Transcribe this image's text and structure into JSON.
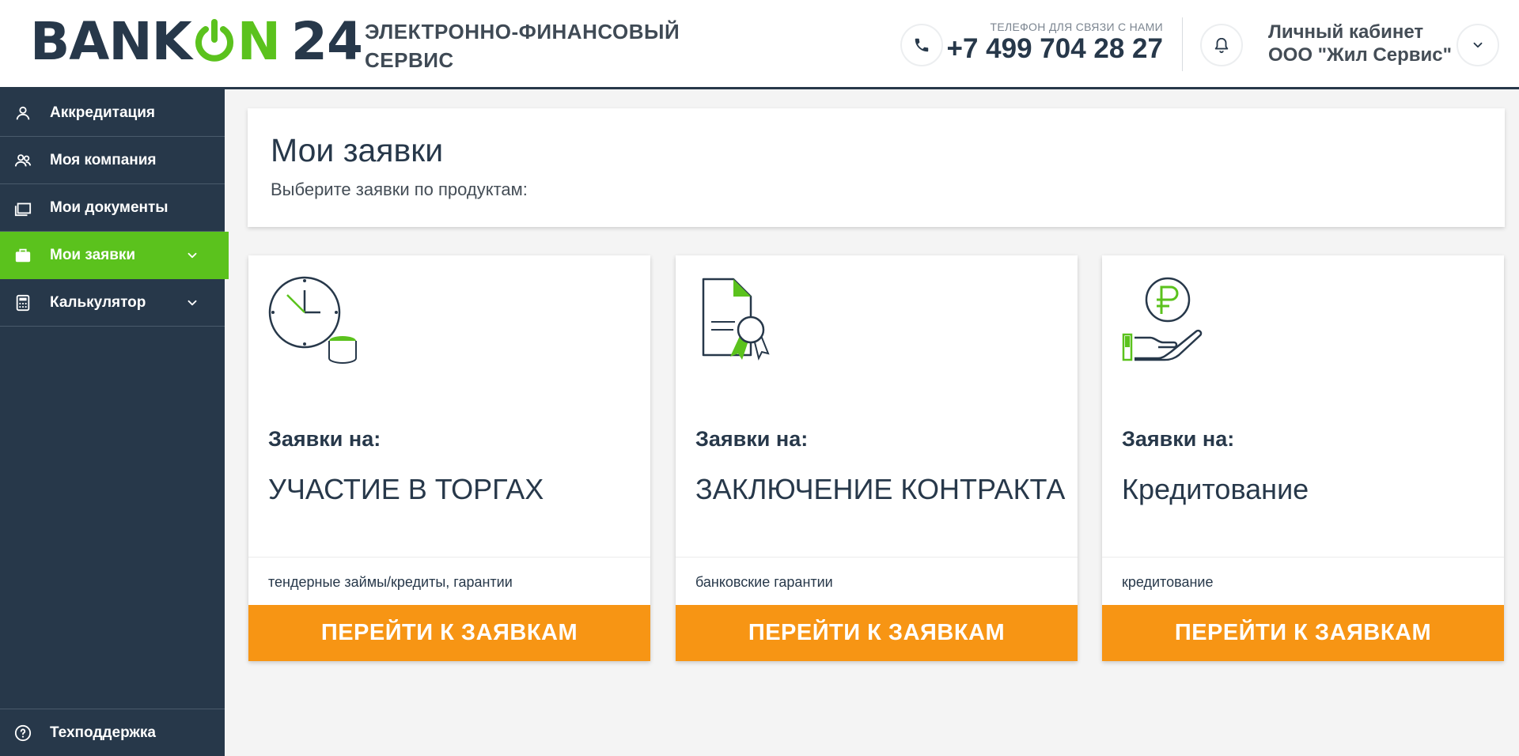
{
  "header": {
    "logo": {
      "part1": "BANK",
      "part2": "N",
      "part3": "24"
    },
    "tagline": "ЭЛЕКТРОННО-ФИНАНСОВЫЙ СЕРВИС",
    "phone_caption": "ТЕЛЕФОН ДЛЯ СВЯЗИ С НАМИ",
    "phone_number": "+7 499 704 28 27",
    "cabinet_label": "Личный кабинет",
    "company_name": "ООО \"Жил Сервис\""
  },
  "sidebar": {
    "items": [
      {
        "label": "Аккредитация",
        "icon": "user-icon"
      },
      {
        "label": "Моя компания",
        "icon": "users-icon"
      },
      {
        "label": "Мои документы",
        "icon": "folder-icon"
      },
      {
        "label": "Мои заявки",
        "icon": "briefcase-icon",
        "active": true
      },
      {
        "label": "Калькулятор",
        "icon": "calculator-icon"
      }
    ],
    "support_label": "Техподдержка"
  },
  "main": {
    "title": "Мои заявки",
    "subtitle": "Выберите заявки по продуктам:",
    "cards": [
      {
        "pre": "Заявки на:",
        "title": "УЧАСТИЕ В ТОРГАХ",
        "desc": "тендерные займы/кредиты, гарантии",
        "button": "ПЕРЕЙТИ К ЗАЯВКАМ",
        "icon": "clock-coins-icon"
      },
      {
        "pre": "Заявки на:",
        "title": "ЗАКЛЮЧЕНИЕ КОНТРАКТА",
        "desc": "банковские гарантии",
        "button": "ПЕРЕЙТИ К ЗАЯВКАМ",
        "icon": "certificate-icon"
      },
      {
        "pre": "Заявки на:",
        "title": "Кредитование",
        "desc": "кредитование",
        "button": "ПЕРЕЙТИ К ЗАЯВКАМ",
        "icon": "ruble-hand-icon"
      }
    ]
  },
  "colors": {
    "brand_dark": "#27384a",
    "brand_green": "#5bc21d",
    "action_orange": "#f79514"
  }
}
